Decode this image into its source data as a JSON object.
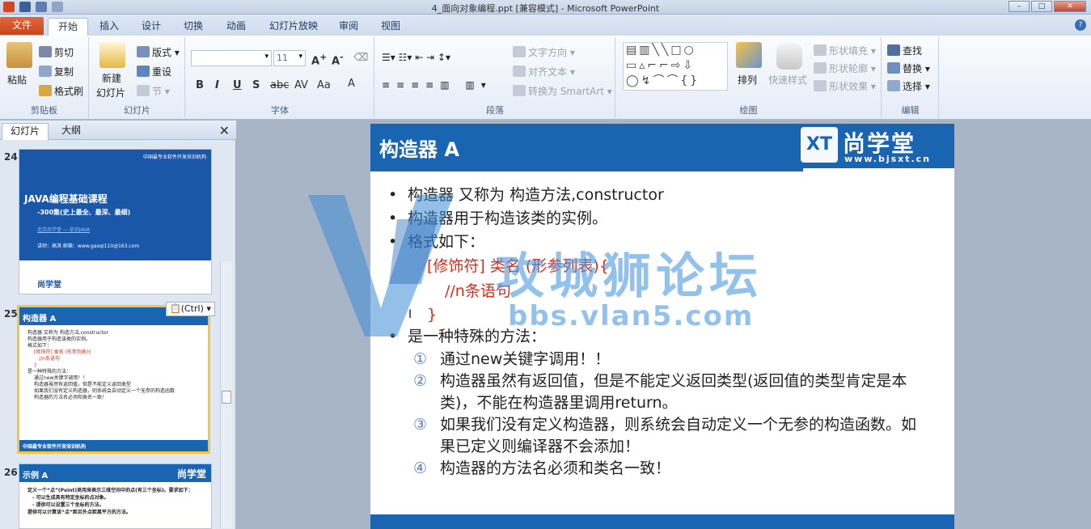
{
  "window": {
    "title": "4_面向对象编程.ppt [兼容模式] - Microsoft PowerPoint"
  },
  "ribbon_tabs": [
    "文件",
    "开始",
    "插入",
    "设计",
    "切换",
    "动画",
    "幻灯片放映",
    "审阅",
    "视图"
  ],
  "clipboard": {
    "paste": "粘贴",
    "cut": "剪切",
    "copy": "复制",
    "format_painter": "格式刷",
    "label": "剪贴板"
  },
  "slides_group": {
    "new_slide_line1": "新建",
    "new_slide_line2": "幻灯片",
    "layout": "版式",
    "reset": "重设",
    "section": "节",
    "label": "幻灯片"
  },
  "font_group": {
    "size": "11",
    "label": "字体"
  },
  "paragraph_group": {
    "text_direction": "文字方向",
    "align_text": "对齐文本",
    "smartart": "转换为 SmartArt",
    "label": "段落"
  },
  "drawing_group": {
    "arrange": "排列",
    "quick_styles": "快速样式",
    "fill": "形状填充",
    "outline": "形状轮廓",
    "effects": "形状效果",
    "label": "绘图"
  },
  "editing_group": {
    "find": "查找",
    "replace": "替换",
    "select": "选择",
    "label": "编辑"
  },
  "left_panel": {
    "tab_slides": "幻灯片",
    "tab_outline": "大纲"
  },
  "thumbnails": [
    {
      "num": "24",
      "top": "中国最专业软件开发培训机构",
      "title": "JAVA编程基础课程",
      "subtitle": "-300集(史上最全、最深、最细)",
      "link": "北京尚学堂 — 初识JAVA",
      "teacher": "讲师：高淇   邮箱：www.gaoqi110@163.com",
      "brand": "尚学堂"
    },
    {
      "num": "25",
      "title": "构造器 A",
      "lines": [
        "构造器 又称为 构造方法,constructor",
        "构造器用于构造该类的实例。",
        "格式如下：",
        "[修饰符] 类名 (形参列表){",
        "//n条语句",
        "}",
        "是一种特殊的方法：",
        "通过new关键字调用！！",
        "构造器虽然有返回值，但是不能定义返回类型",
        "如果我们没有定义构造器，则系统会自动定义一个无参的构造函数",
        "构造器的方法名必须和类名一致！"
      ],
      "footer": "中国最专业软件开发培训机构"
    },
    {
      "num": "26",
      "title": "示例 A",
      "brand": "尚学堂",
      "lines": [
        "定义一个“点”(Point)类用来表示三维空间中的点(有三个坐标)。要求如下：",
        "- 可以生成具有特定坐标的点对象。",
        "- 提供可以设置三个坐标的方法。",
        "提供可以计算该“点”距另外点距离平方的方法。"
      ]
    }
  ],
  "paste_option": "(Ctrl)",
  "slide": {
    "title": "构造器 A",
    "logo_name": "尚学堂",
    "logo_url": "www.bjsxt.cn",
    "bullets": [
      "构造器 又称为 构造方法,constructor",
      "构造器用于构造该类的实例。",
      "格式如下："
    ],
    "code": [
      "[修饰符]  类名 (形参列表){",
      "//n条语句",
      "}"
    ],
    "bullet4": "是一种特殊的方法：",
    "items": [
      {
        "n": "①",
        "text": "通过new关键字调用！！"
      },
      {
        "n": "②",
        "text": "构造器虽然有返回值，但是不能定义返回类型(返回值的类型肯定是本类)，不能在构造器里调用return。"
      },
      {
        "n": "③",
        "text": "如果我们没有定义构造器，则系统会自动定义一个无参的构造函数。如果已定义则编译器不会添加！"
      },
      {
        "n": "④",
        "text": "构造器的方法名必须和类名一致！"
      }
    ]
  },
  "watermark": {
    "cn": "攻城狮论坛",
    "url": "bbs.vlan5.com"
  }
}
